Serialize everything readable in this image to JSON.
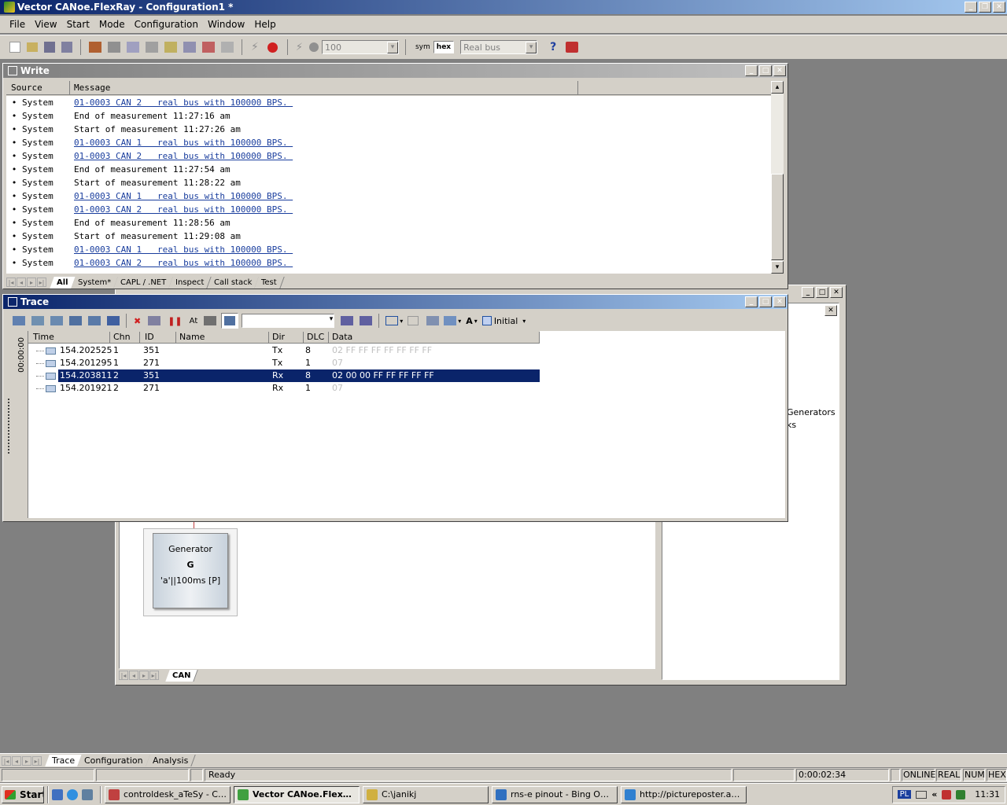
{
  "app": {
    "title": "Vector CANoe.FlexRay  - Configuration1 *",
    "menu": [
      "File",
      "View",
      "Start",
      "Mode",
      "Configuration",
      "Window",
      "Help"
    ]
  },
  "toolbar": {
    "speed_value": "100",
    "sym_label": "sym",
    "hex_label": "hex",
    "bus_mode": "Real bus"
  },
  "write": {
    "title": "Write",
    "col_source": "Source",
    "col_message": "Message",
    "rows": [
      {
        "source": "System",
        "message": "01-0003 CAN 2   real bus with 100000 BPS. ",
        "link": true
      },
      {
        "source": "System",
        "message": "End of measurement 11:27:16 am",
        "link": false
      },
      {
        "source": "System",
        "message": "Start of measurement 11:27:26 am",
        "link": false
      },
      {
        "source": "System",
        "message": "01-0003 CAN 1   real bus with 100000 BPS. ",
        "link": true
      },
      {
        "source": "System",
        "message": "01-0003 CAN 2   real bus with 100000 BPS. ",
        "link": true
      },
      {
        "source": "System",
        "message": "End of measurement 11:27:54 am",
        "link": false
      },
      {
        "source": "System",
        "message": "Start of measurement 11:28:22 am",
        "link": false
      },
      {
        "source": "System",
        "message": "01-0003 CAN 1   real bus with 100000 BPS. ",
        "link": true
      },
      {
        "source": "System",
        "message": "01-0003 CAN 2   real bus with 100000 BPS. ",
        "link": true
      },
      {
        "source": "System",
        "message": "End of measurement 11:28:56 am",
        "link": false
      },
      {
        "source": "System",
        "message": "Start of measurement 11:29:08 am",
        "link": false
      },
      {
        "source": "System",
        "message": "01-0003 CAN 1   real bus with 100000 BPS. ",
        "link": true
      },
      {
        "source": "System",
        "message": "01-0003 CAN 2   real bus with 100000 BPS. ",
        "link": true
      }
    ],
    "tabs": [
      "All",
      "System*",
      "CAPL / .NET",
      "Inspect",
      "Call stack",
      "Test"
    ],
    "active_tab": "All"
  },
  "trace": {
    "title": "Trace",
    "view_mode": "Initial",
    "time_axis": "00:00:00",
    "columns": [
      "Time",
      "Chn",
      "ID",
      "Name",
      "Dir",
      "DLC",
      "Data"
    ],
    "rows": [
      {
        "time": "154.202525",
        "chn": "1",
        "id": "351",
        "name": "",
        "dir": "Tx",
        "dlc": "8",
        "data": "02 FF FF FF FF FF FF FF",
        "selected": false,
        "dim": true
      },
      {
        "time": "154.201295",
        "chn": "1",
        "id": "271",
        "name": "",
        "dir": "Tx",
        "dlc": "1",
        "data": "07",
        "selected": false,
        "dim": true
      },
      {
        "time": "154.203811",
        "chn": "2",
        "id": "351",
        "name": "",
        "dir": "Rx",
        "dlc": "8",
        "data": "02 00 00 FF FF FF FF FF",
        "selected": true,
        "dim": false
      },
      {
        "time": "154.201921",
        "chn": "2",
        "id": "271",
        "name": "",
        "dir": "Rx",
        "dlc": "1",
        "data": "07",
        "selected": false,
        "dim": true
      }
    ]
  },
  "simulation": {
    "generator_title": "Generator",
    "generator_letter": "G",
    "generator_info": "'a'||100ms [P]",
    "tab": "CAN"
  },
  "side_panel": {
    "line1": "Generators",
    "line2": "ks"
  },
  "bottom_tabs": [
    "Trace",
    "Configuration",
    "Analysis"
  ],
  "active_bottom_tab": "Trace",
  "status": {
    "ready": "Ready",
    "elapsed": "0:00:02:34",
    "online": "ONLINE",
    "real": "REAL",
    "num": "NUM",
    "hex": "HEX"
  },
  "taskbar": {
    "start": "Start",
    "tasks": [
      {
        "label": "controldesk_aTeSy - Con...",
        "active": false
      },
      {
        "label": "Vector CANoe.FlexRa...",
        "active": true
      },
      {
        "label": "C:\\janikj",
        "active": false
      },
      {
        "label": "rns-e pinout - Bing Obraz...",
        "active": false
      },
      {
        "label": "http://pictureposter.audi....",
        "active": false
      }
    ],
    "lang": "PL",
    "clock": "11:31"
  },
  "colors": {
    "titlebar_active": "#0a246a",
    "titlebar_gradient_end": "#a6caf0",
    "titlebar_inactive": "#808080",
    "selection": "#0a246a",
    "link": "#1a3e9e"
  }
}
